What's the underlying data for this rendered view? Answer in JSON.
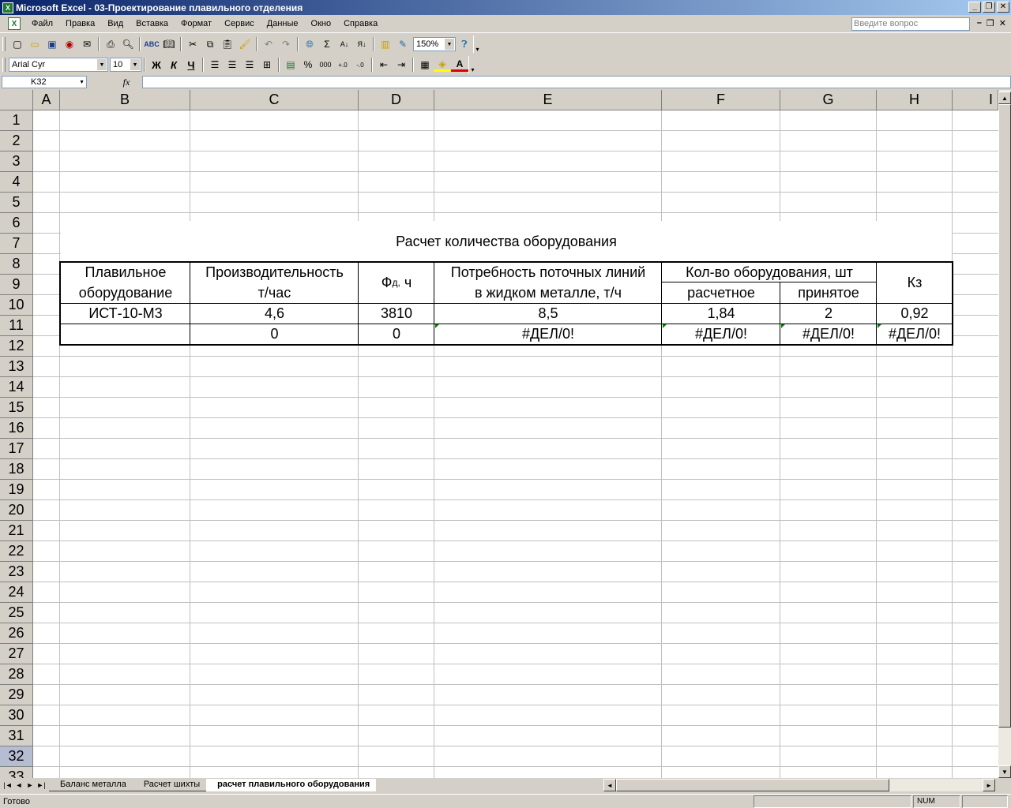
{
  "window": {
    "title": "Microsoft Excel - 03-Проектирование плавильного отделения",
    "app_icon": "X",
    "buttons": [
      "_",
      "❐",
      "✕"
    ]
  },
  "menu": {
    "items": [
      "Файл",
      "Правка",
      "Вид",
      "Вставка",
      "Формат",
      "Сервис",
      "Данные",
      "Окно",
      "Справка"
    ],
    "help_placeholder": "Введите вопрос"
  },
  "toolbar": {
    "zoom": "150%",
    "font_name": "Arial Cyr",
    "font_size": "10",
    "bold": "Ж",
    "italic": "К",
    "underline": "Ч",
    "percent": "%",
    "thousands": "000",
    "sum": "Σ"
  },
  "formula_bar": {
    "name_box": "K32",
    "fx": "fx",
    "formula": ""
  },
  "columns": [
    "A",
    "B",
    "C",
    "D",
    "E",
    "F",
    "G",
    "H",
    "I"
  ],
  "rows": [
    "1",
    "2",
    "3",
    "4",
    "5",
    "6",
    "7",
    "8",
    "9",
    "10",
    "11",
    "12",
    "13",
    "14",
    "15",
    "16",
    "17",
    "18",
    "19",
    "20",
    "21",
    "22",
    "23",
    "24",
    "25",
    "26",
    "27",
    "28",
    "29",
    "30",
    "31",
    "32",
    "33"
  ],
  "selected_row": "32",
  "sheet": {
    "title": "Расчет количества оборудования",
    "header": {
      "b": [
        "Плавильное",
        "оборудование"
      ],
      "c": [
        "Производительность",
        "т/час"
      ],
      "d_main": "Ф",
      "d_sub": "д,",
      "d_tail": " ч",
      "e": [
        "Потребность поточных линий",
        "в жидком металле, т/ч"
      ],
      "fg": "Кол-во оборудования, шт",
      "f": "расчетное",
      "g": "принятое",
      "h": "Кз"
    },
    "row6": {
      "b": "ИСТ-10-М3",
      "c": "4,6",
      "d": "3810",
      "e": "8,5",
      "f": "1,84",
      "g": "2",
      "h": "0,92"
    },
    "row7": {
      "b": "",
      "c": "0",
      "d": "0",
      "e": "#ДЕЛ/0!",
      "f": "#ДЕЛ/0!",
      "g": "#ДЕЛ/0!",
      "h": "#ДЕЛ/0!"
    }
  },
  "tabs": {
    "nav": [
      "|◄",
      "◄",
      "►",
      "►|"
    ],
    "sheets": [
      "Баланс металла",
      "Расчет шихты",
      "расчет плавильного оборудования"
    ],
    "active_index": 2
  },
  "status": {
    "ready": "Готово",
    "num": "NUM"
  }
}
